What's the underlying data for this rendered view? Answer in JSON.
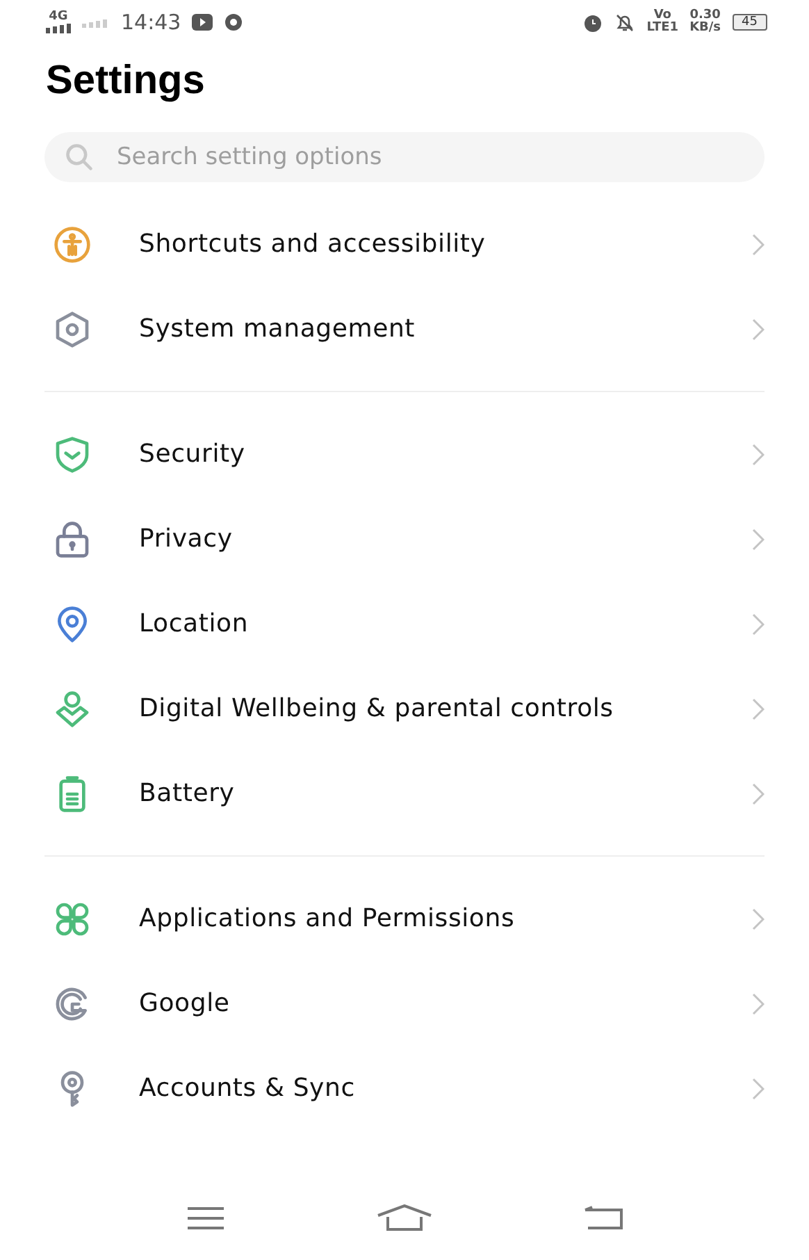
{
  "status_bar": {
    "network": "4G",
    "time": "14:43",
    "volte_top": "Vo",
    "volte_bottom": "LTE1",
    "speed_value": "0.30",
    "speed_unit": "KB/s",
    "battery": "45"
  },
  "title": "Settings",
  "search": {
    "placeholder": "Search setting options"
  },
  "sections": [
    {
      "items": [
        {
          "label": "Shortcuts and accessibility"
        },
        {
          "label": "System management"
        }
      ]
    },
    {
      "items": [
        {
          "label": "Security"
        },
        {
          "label": "Privacy"
        },
        {
          "label": "Location"
        },
        {
          "label": "Digital Wellbeing & parental controls"
        },
        {
          "label": "Battery"
        }
      ]
    },
    {
      "items": [
        {
          "label": "Applications and Permissions"
        },
        {
          "label": "Google"
        },
        {
          "label": "Accounts & Sync"
        }
      ]
    }
  ]
}
